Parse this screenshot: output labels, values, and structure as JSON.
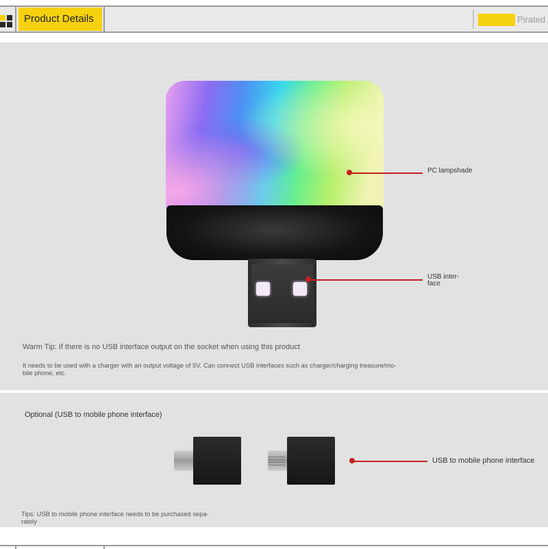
{
  "header": {
    "title": "Product Details",
    "right_text": "Pirated"
  },
  "product": {
    "callouts": {
      "shade": "PC lampshade",
      "usb_line1": "USB inter-",
      "usb_line2": "face"
    },
    "warm_tip_title": "Warm Tip: If there is no USB interface output on the socket when using this product",
    "warm_tip_line1": "It needs to be used with a charger with an output voltage of 5V. Can connect USB interfaces such as charger/charging treasure/mo-",
    "warm_tip_line2": "bile phone, etc."
  },
  "optional": {
    "title": "Optional (USB to mobile phone interface)",
    "callout": "USB to mobile phone interface",
    "tips_line1": "Tips: USB to mobile phone interface needs to be purchased sepa-",
    "tips_line2": "rately"
  },
  "colors": {
    "accent": "#f6d10f",
    "panel": "#e2e2e2",
    "callout": "#c61f1f"
  },
  "icons": [
    "grid-icon"
  ]
}
